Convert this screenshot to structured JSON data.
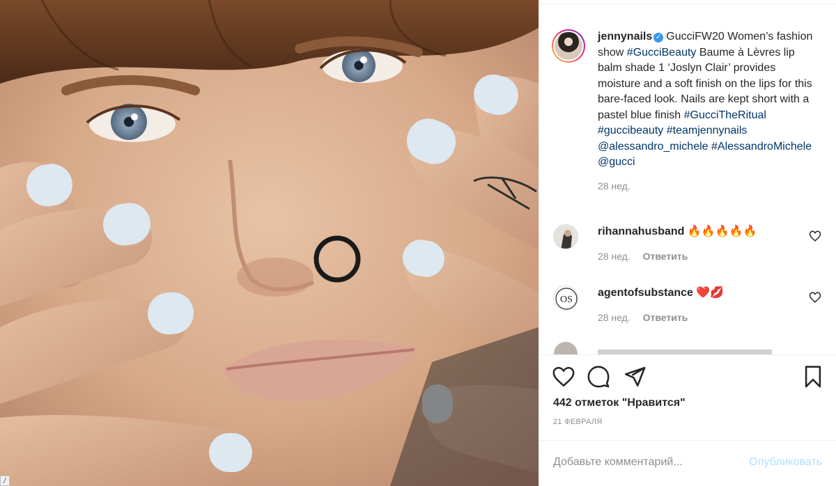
{
  "photo": {
    "alt": "",
    "corner_label": "/"
  },
  "post": {
    "username": "jennynails",
    "caption_parts": [
      {
        "t": "GucciFW20 Women’s fashion show ",
        "tag": false
      },
      {
        "t": "#GucciBeauty",
        "tag": true
      },
      {
        "t": " Baume à Lèvres lip balm shade 1 ‘Joslyn Clair’ provides moisture and a soft finish on the lips for this bare-faced look. Nails are kept short with a pastel blue finish ",
        "tag": false
      },
      {
        "t": "#GucciTheRitual",
        "tag": true
      },
      {
        "t": " ",
        "tag": false
      },
      {
        "t": "#guccibeauty",
        "tag": true
      },
      {
        "t": " ",
        "tag": false
      },
      {
        "t": "#teamjennynails",
        "tag": true
      },
      {
        "t": " ",
        "tag": false
      },
      {
        "t": "@alessandro_michele",
        "tag": true
      },
      {
        "t": " ",
        "tag": false
      },
      {
        "t": "#AlessandroMichele",
        "tag": true
      },
      {
        "t": " ",
        "tag": false
      },
      {
        "t": "@gucci",
        "tag": true
      }
    ],
    "caption_time": "28 нед."
  },
  "comments": [
    {
      "user": "rihannahusband",
      "text": "🔥🔥🔥🔥🔥",
      "time": "28 нед.",
      "reply": "Ответить"
    },
    {
      "user": "agentofsubstance",
      "text": "❤️💋",
      "time": "28 нед.",
      "reply": "Ответить",
      "avatar_text": "OS"
    }
  ],
  "actions": {
    "likes": "442 отметок \"Нравится\"",
    "date": "21 ФЕВРАЛЯ"
  },
  "comment_box": {
    "placeholder": "Добавьте комментарий...",
    "publish": "Опубликовать"
  },
  "colors": {
    "link": "#003569",
    "muted": "#8e8e8e",
    "publish_disabled": "#b2dffc",
    "verified": "#3897f0"
  }
}
